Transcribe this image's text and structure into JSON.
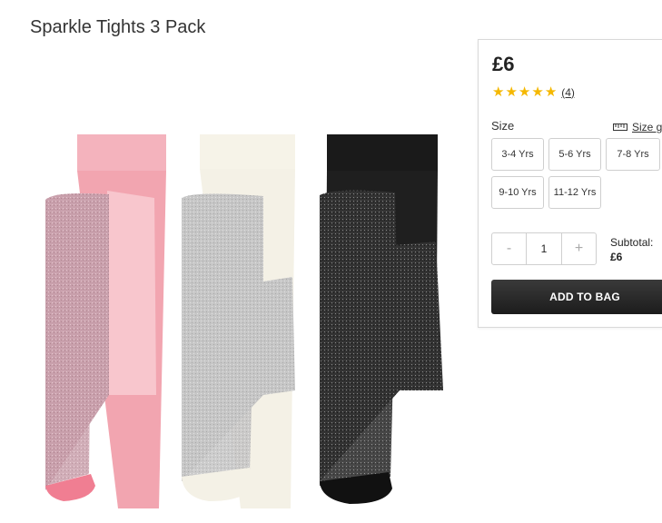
{
  "product": {
    "title": "Sparkle Tights 3 Pack",
    "price": "£6",
    "rating": 5,
    "review_count": "(4)"
  },
  "size_section": {
    "label": "Size",
    "guide_label": "Size g",
    "options": [
      "3-4 Yrs",
      "5-6 Yrs",
      "7-8 Yrs",
      "9-10 Yrs",
      "11-12 Yrs"
    ]
  },
  "quantity": {
    "minus": "-",
    "value": "1",
    "plus": "+"
  },
  "subtotal": {
    "label": "Subtotal:",
    "value": "£6"
  },
  "add_to_bag": "ADD TO BAG",
  "colors": {
    "pink_tights": "#f2a5b0",
    "pink_sparkle": "#c9a0ac",
    "cream_tights": "#f4f1e6",
    "silver_sparkle": "#c6c6c6",
    "black_tights": "#1a1a1a",
    "black_sparkle": "#3c3c3c",
    "star": "#f5b800",
    "button": "#2a2a2a"
  }
}
